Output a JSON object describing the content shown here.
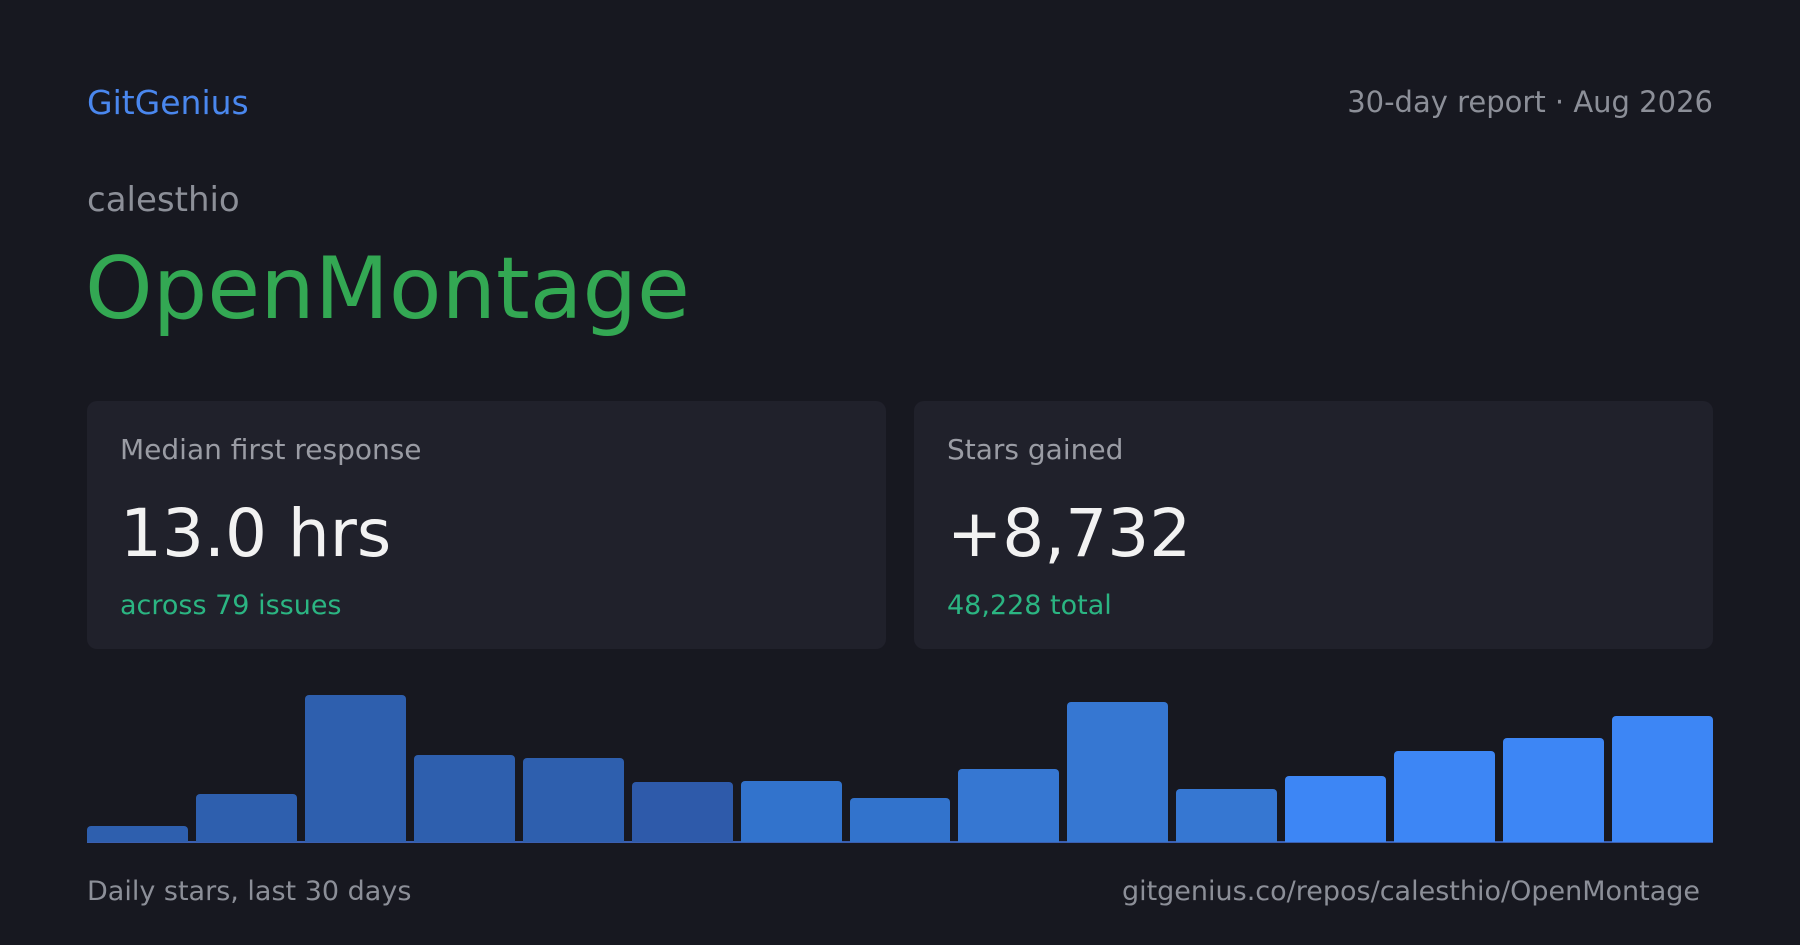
{
  "header": {
    "brand": "GitGenius",
    "report": "30-day report · Aug 2026"
  },
  "repo": {
    "owner": "calesthio",
    "name": "OpenMontage"
  },
  "cards": [
    {
      "label": "Median first response",
      "value": "13.0 hrs",
      "sub": "across 79 issues"
    },
    {
      "label": "Stars gained",
      "value": "+8,732",
      "sub": "48,228 total"
    }
  ],
  "chart_data": {
    "type": "bar",
    "title": "",
    "xlabel": "",
    "ylabel": "",
    "categories": [],
    "values": [
      16,
      47,
      144,
      85,
      82,
      59,
      60,
      43,
      72,
      137,
      52,
      65,
      89,
      102,
      124
    ],
    "ylim": [
      0,
      150
    ],
    "grid": false,
    "legend": "none",
    "colors": [
      "#2e5fae",
      "#2e5fae",
      "#2e5fae",
      "#2e5fae",
      "#2e5fae",
      "#2e5aaa",
      "#3273cc",
      "#3273cc",
      "#3677d2",
      "#3677d2",
      "#3677d2",
      "#3d86f5",
      "#3d86f5",
      "#3d86f5",
      "#3d86f5"
    ]
  },
  "footer": {
    "caption": "Daily stars, last 30 days",
    "url": "gitgenius.co/repos/calesthio/OpenMontage"
  },
  "colors": {
    "background": "#171820",
    "card": "#20212b",
    "brand": "#4a87ee",
    "repo": "#33a853",
    "positive": "#2bb582",
    "muted": "#8c8f98"
  }
}
